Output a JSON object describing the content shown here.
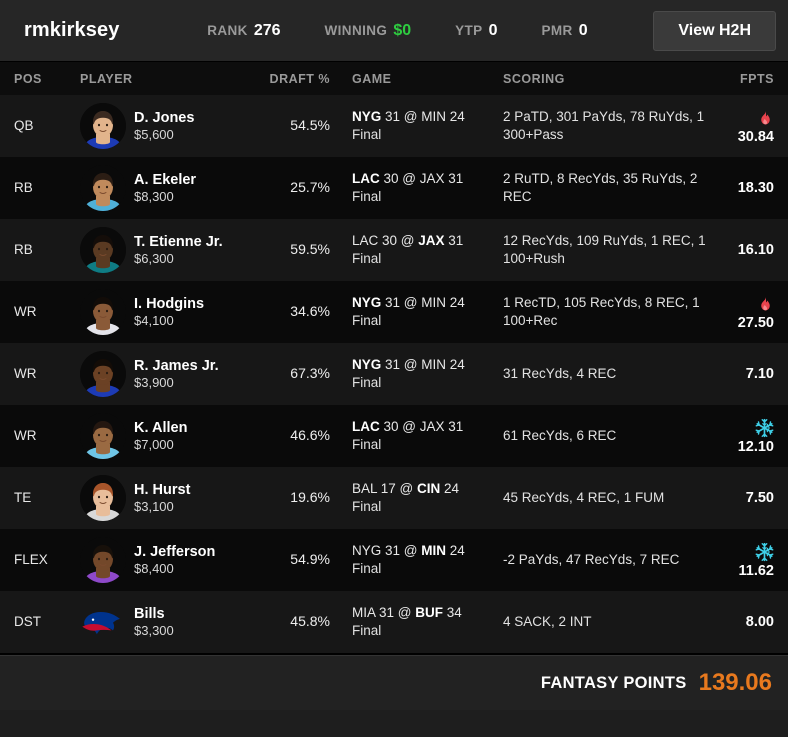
{
  "header": {
    "username": "rmkirksey",
    "stats": [
      {
        "label": "RANK",
        "value": "276",
        "color": "#ffffff"
      },
      {
        "label": "WINNING",
        "value": "$0",
        "color": "#2ecc40"
      },
      {
        "label": "YTP",
        "value": "0",
        "color": "#ffffff"
      },
      {
        "label": "PMR",
        "value": "0",
        "color": "#ffffff"
      }
    ],
    "h2h_button": "View H2H"
  },
  "columns": {
    "pos": "POS",
    "player": "PLAYER",
    "draft": "DRAFT %",
    "game": "GAME",
    "scoring": "SCORING",
    "fpts": "FPTS"
  },
  "rows": [
    {
      "pos": "QB",
      "name": "D. Jones",
      "salary": "$5,600",
      "draft_pct": "54.5%",
      "game": {
        "away": "NYG",
        "away_score": "31",
        "home": "MIN",
        "home_score": "24",
        "bold": "away",
        "status": "Final"
      },
      "scoring": "2 PaTD, 301 PaYds, 78 RuYds, 1 300+Pass",
      "fpts": "30.84",
      "fpts_icon": "fire-icon",
      "avatar": {
        "type": "headshot",
        "skin": "#e2b48c",
        "hair": "#3b2a20",
        "jersey": "#1d3bb5"
      }
    },
    {
      "pos": "RB",
      "name": "A. Ekeler",
      "salary": "$8,300",
      "draft_pct": "25.7%",
      "game": {
        "away": "LAC",
        "away_score": "30",
        "home": "JAX",
        "home_score": "31",
        "bold": "away",
        "status": "Final"
      },
      "scoring": "2 RuTD, 8 RecYds, 35 RuYds, 2 REC",
      "fpts": "18.30",
      "fpts_icon": "none",
      "avatar": {
        "type": "headshot",
        "skin": "#c08a5c",
        "hair": "#2b1d14",
        "jersey": "#4fb0d8"
      }
    },
    {
      "pos": "RB",
      "name": "T. Etienne Jr.",
      "salary": "$6,300",
      "draft_pct": "59.5%",
      "game": {
        "away": "LAC",
        "away_score": "30",
        "home": "JAX",
        "home_score": "31",
        "bold": "home",
        "status": "Final"
      },
      "scoring": "12 RecYds, 109 RuYds, 1 REC, 1 100+Rush",
      "fpts": "16.10",
      "fpts_icon": "none",
      "avatar": {
        "type": "headshot",
        "skin": "#5a3a22",
        "hair": "#140d09",
        "jersey": "#0f7c84"
      }
    },
    {
      "pos": "WR",
      "name": "I. Hodgins",
      "salary": "$4,100",
      "draft_pct": "34.6%",
      "game": {
        "away": "NYG",
        "away_score": "31",
        "home": "MIN",
        "home_score": "24",
        "bold": "away",
        "status": "Final"
      },
      "scoring": "1 RecTD, 105 RecYds, 8 REC, 1 100+Rec",
      "fpts": "27.50",
      "fpts_icon": "fire-icon",
      "avatar": {
        "type": "headshot",
        "skin": "#8a5a38",
        "hair": "#120c08",
        "jersey": "#e4e4ea"
      }
    },
    {
      "pos": "WR",
      "name": "R. James Jr.",
      "salary": "$3,900",
      "draft_pct": "67.3%",
      "game": {
        "away": "NYG",
        "away_score": "31",
        "home": "MIN",
        "home_score": "24",
        "bold": "away",
        "status": "Final"
      },
      "scoring": "31 RecYds, 4 REC",
      "fpts": "7.10",
      "fpts_icon": "none",
      "avatar": {
        "type": "headshot",
        "skin": "#6b4124",
        "hair": "#130c07",
        "jersey": "#1d3bb5"
      }
    },
    {
      "pos": "WR",
      "name": "K. Allen",
      "salary": "$7,000",
      "draft_pct": "46.6%",
      "game": {
        "away": "LAC",
        "away_score": "30",
        "home": "JAX",
        "home_score": "31",
        "bold": "away",
        "status": "Final"
      },
      "scoring": "61 RecYds, 6 REC",
      "fpts": "12.10",
      "fpts_icon": "snowflake-icon",
      "avatar": {
        "type": "headshot",
        "skin": "#9a6a42",
        "hair": "#241710",
        "jersey": "#6fc5e6"
      }
    },
    {
      "pos": "TE",
      "name": "H. Hurst",
      "salary": "$3,100",
      "draft_pct": "19.6%",
      "game": {
        "away": "BAL",
        "away_score": "17",
        "home": "CIN",
        "home_score": "24",
        "bold": "home",
        "status": "Final"
      },
      "scoring": "45 RecYds, 4 REC, 1 FUM",
      "fpts": "7.50",
      "fpts_icon": "none",
      "avatar": {
        "type": "headshot",
        "skin": "#e8bd9a",
        "hair": "#a8552a",
        "jersey": "#d8d8d8"
      }
    },
    {
      "pos": "FLEX",
      "name": "J. Jefferson",
      "salary": "$8,400",
      "draft_pct": "54.9%",
      "game": {
        "away": "NYG",
        "away_score": "31",
        "home": "MIN",
        "home_score": "24",
        "bold": "home",
        "status": "Final"
      },
      "scoring": "-2 PaYds, 47 RecYds, 7 REC",
      "fpts": "11.62",
      "fpts_icon": "snowflake-icon",
      "avatar": {
        "type": "headshot",
        "skin": "#73482a",
        "hair": "#17100a",
        "jersey": "#8e49c9"
      }
    },
    {
      "pos": "DST",
      "name": "Bills",
      "salary": "$3,300",
      "draft_pct": "45.8%",
      "game": {
        "away": "MIA",
        "away_score": "31",
        "home": "BUF",
        "home_score": "34",
        "bold": "home",
        "status": "Final"
      },
      "scoring": "4 SACK, 2 INT",
      "fpts": "8.00",
      "fpts_icon": "none",
      "avatar": {
        "type": "team-logo",
        "team": "bills-logo",
        "primary": "#00338d",
        "secondary": "#c60c30"
      }
    }
  ],
  "footer": {
    "label": "FANTASY POINTS",
    "total": "139.06",
    "total_color": "#e8791e"
  }
}
